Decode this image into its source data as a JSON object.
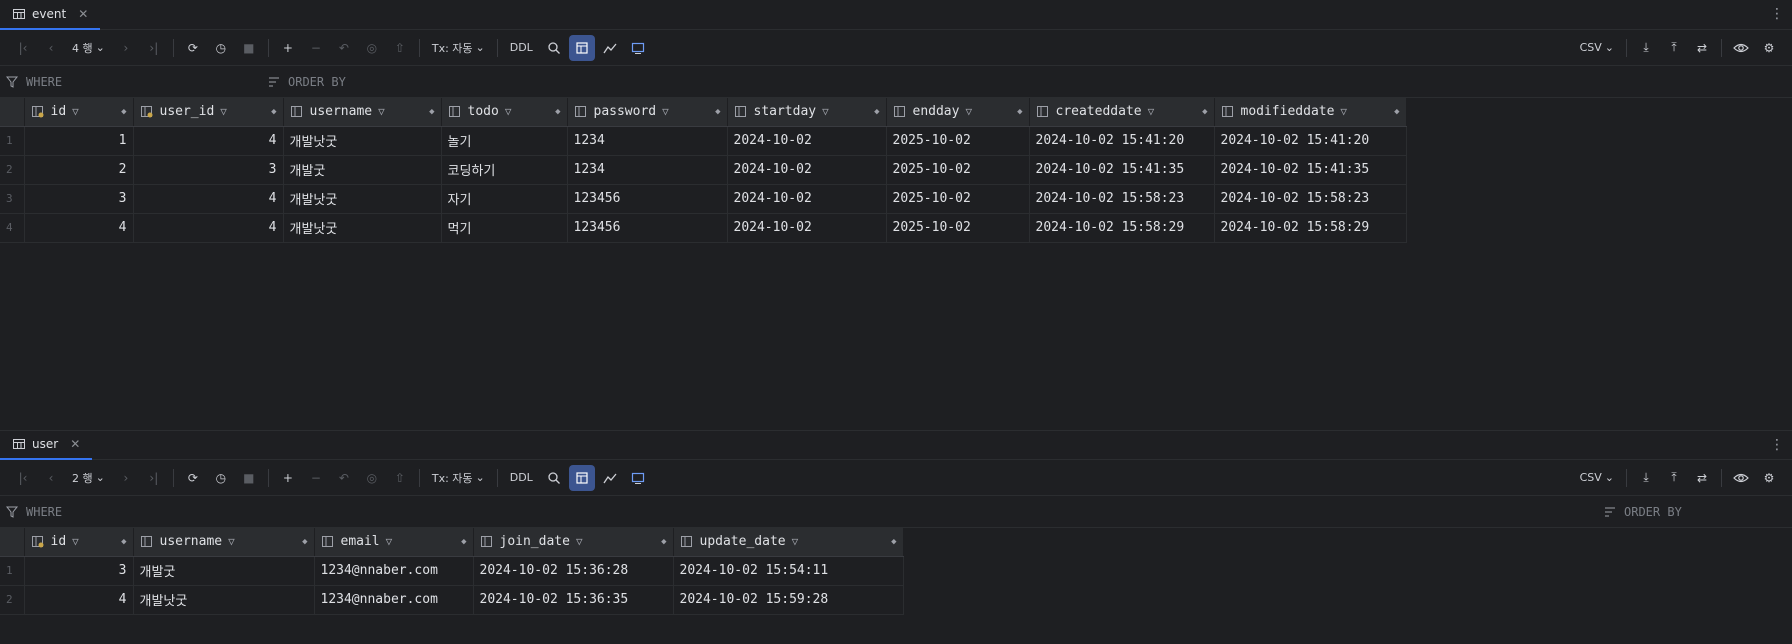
{
  "event_panel": {
    "tab_label": "event",
    "rows_label": "4 행",
    "tx_label": "Tx: 자동",
    "ddl_label": "DDL",
    "csv_label": "CSV",
    "where_label": "WHERE",
    "orderby_label": "ORDER BY",
    "columns": [
      {
        "name": "id",
        "key": true
      },
      {
        "name": "user_id",
        "key": true
      },
      {
        "name": "username"
      },
      {
        "name": "todo"
      },
      {
        "name": "password"
      },
      {
        "name": "startday"
      },
      {
        "name": "endday"
      },
      {
        "name": "createddate"
      },
      {
        "name": "modifieddate"
      }
    ],
    "rows": [
      [
        "1",
        "4",
        "개발낫굿",
        "놀기",
        "1234",
        "2024-10-02",
        "2025-10-02",
        "2024-10-02 15:41:20",
        "2024-10-02 15:41:20"
      ],
      [
        "2",
        "3",
        "개발굿",
        "코딩하기",
        "1234",
        "2024-10-02",
        "2025-10-02",
        "2024-10-02 15:41:35",
        "2024-10-02 15:41:35"
      ],
      [
        "3",
        "4",
        "개발낫굿",
        "자기",
        "123456",
        "2024-10-02",
        "2025-10-02",
        "2024-10-02 15:58:23",
        "2024-10-02 15:58:23"
      ],
      [
        "4",
        "4",
        "개발낫굿",
        "먹기",
        "123456",
        "2024-10-02",
        "2025-10-02",
        "2024-10-02 15:58:29",
        "2024-10-02 15:58:29"
      ]
    ],
    "row_numbers": [
      "1",
      "2",
      "3",
      "4"
    ]
  },
  "user_panel": {
    "tab_label": "user",
    "rows_label": "2 행",
    "tx_label": "Tx: 자동",
    "ddl_label": "DDL",
    "csv_label": "CSV",
    "where_label": "WHERE",
    "orderby_label": "ORDER BY",
    "columns": [
      {
        "name": "id",
        "key": true
      },
      {
        "name": "username"
      },
      {
        "name": "email"
      },
      {
        "name": "join_date"
      },
      {
        "name": "update_date"
      }
    ],
    "rows": [
      [
        "3",
        "개발굿",
        "1234@nnaber.com",
        "2024-10-02 15:36:28",
        "2024-10-02 15:54:11"
      ],
      [
        "4",
        "개발낫굿",
        "1234@nnaber.com",
        "2024-10-02 15:36:35",
        "2024-10-02 15:59:28"
      ]
    ],
    "row_numbers": [
      "1",
      "2"
    ]
  },
  "colors": {
    "background": "#1e1f22",
    "header": "#2b2d30",
    "accent": "#3574f0",
    "key_icon": "#c9a64a",
    "col_icon": "#9da0a8"
  }
}
